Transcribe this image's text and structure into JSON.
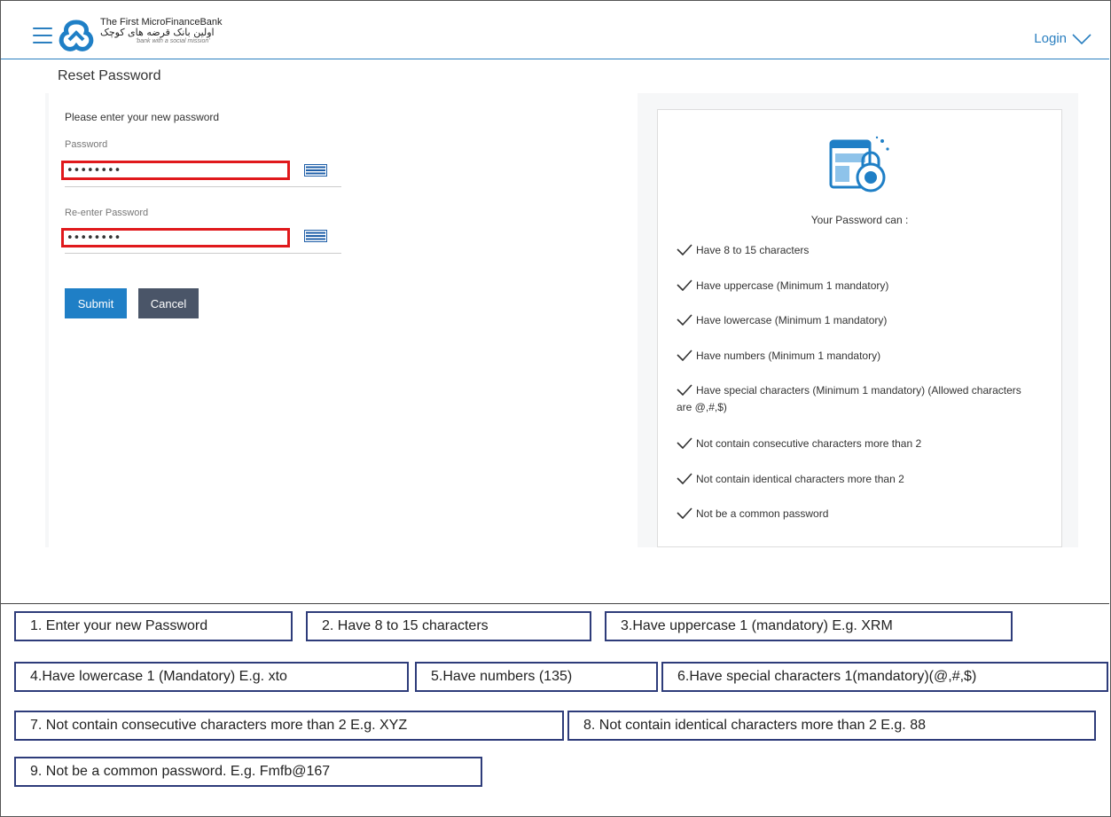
{
  "header": {
    "bank_name_en": "The First MicroFinanceBank",
    "bank_name_fa": "اولین بانک قرضه های کوچک",
    "tagline": "'bank with a social mission'",
    "login_label": "Login"
  },
  "page": {
    "title": "Reset Password",
    "instruction": "Please enter your new password"
  },
  "form": {
    "password_label": "Password",
    "password_value": "••••••••",
    "reenter_label": "Re-enter Password",
    "reenter_value": "••••••••",
    "submit_label": "Submit",
    "cancel_label": "Cancel"
  },
  "rules": {
    "title": "Your Password can :",
    "items": [
      "Have 8 to 15 characters",
      "Have uppercase (Minimum 1 mandatory)",
      "Have lowercase (Minimum 1 mandatory)",
      "Have numbers (Minimum 1 mandatory)",
      "Have special characters (Minimum 1 mandatory) (Allowed characters are @,#,$)",
      "Not contain consecutive characters more than 2",
      "Not contain identical characters more than 2",
      "Not be a common password"
    ]
  },
  "captions": [
    "1. Enter your new Password",
    "2. Have 8 to 15 characters",
    "3.Have uppercase 1 (mandatory) E.g. XRM",
    "4.Have lowercase 1 (Mandatory) E.g. xto",
    "5.Have numbers (135)",
    "6.Have special characters 1(mandatory)(@,#,$)",
    "7. Not contain consecutive characters more than 2 E.g. XYZ",
    "8. Not contain identical characters more than 2 E.g. 88",
    "9. Not be a common password.   E.g.  Fmfb@167"
  ],
  "colors": {
    "brand_blue": "#2a7fc0",
    "submit_blue": "#1f7fc6",
    "cancel_gray": "#4a5568",
    "highlight_red": "#e0191c",
    "caption_border": "#2e3c7a"
  },
  "icons": {
    "menu": "hamburger-icon",
    "logo": "bank-logo",
    "login_chevron": "chevron-down-icon",
    "keyboard": "keyboard-icon",
    "lock": "secure-lock-icon",
    "check": "check-icon"
  }
}
